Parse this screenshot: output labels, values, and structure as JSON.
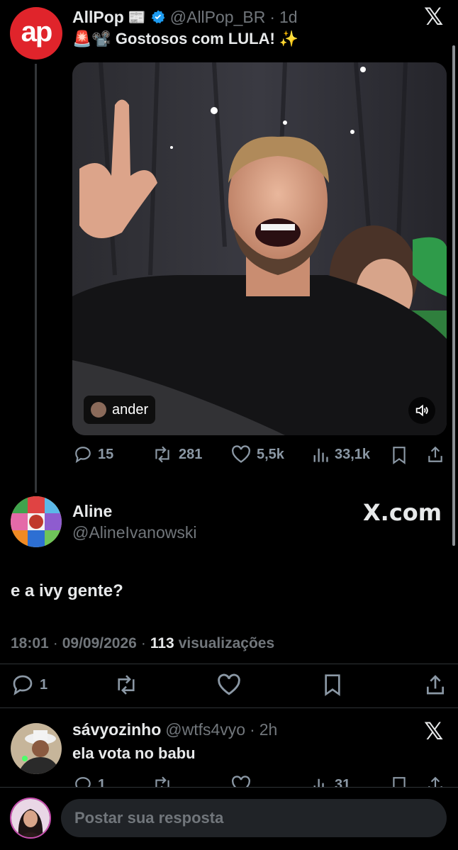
{
  "quoted_tweet": {
    "avatar_text": "ap",
    "name": "AllPop",
    "name_emoji": "📰",
    "handle": "@AllPop_BR",
    "time": "1d",
    "text": "🚨📽️ Gostosos com LULA! ✨",
    "media_tag": "ander",
    "stats": {
      "replies": "15",
      "reposts": "281",
      "likes": "5,5k",
      "views": "33,1k"
    }
  },
  "main_tweet": {
    "name": "Aline",
    "handle": "@AlineIvanowski",
    "watermark": "X.com",
    "text": "e a ivy gente?",
    "time": "18:01",
    "date": "09/09/2026",
    "views_count": "113",
    "views_label": "visualizações",
    "stats": {
      "replies": "1"
    }
  },
  "reply_tweet": {
    "name": "sávyozinho",
    "handle": "@wtfs4vyo",
    "time": "2h",
    "text": "ela vota no babu",
    "stats": {
      "replies": "1",
      "views": "31"
    }
  },
  "composer": {
    "placeholder": "Postar sua resposta"
  },
  "colors": {
    "background": "#000000",
    "text": "#e7e9ea",
    "muted": "#71767b",
    "verified": "#1d9bf0",
    "brand_red": "#e0242b",
    "input_bg": "#202327"
  },
  "icons": [
    "x-logo-icon",
    "verified-badge-icon",
    "reply-icon",
    "repost-icon",
    "like-icon",
    "views-icon",
    "bookmark-icon",
    "share-icon",
    "speaker-icon"
  ]
}
